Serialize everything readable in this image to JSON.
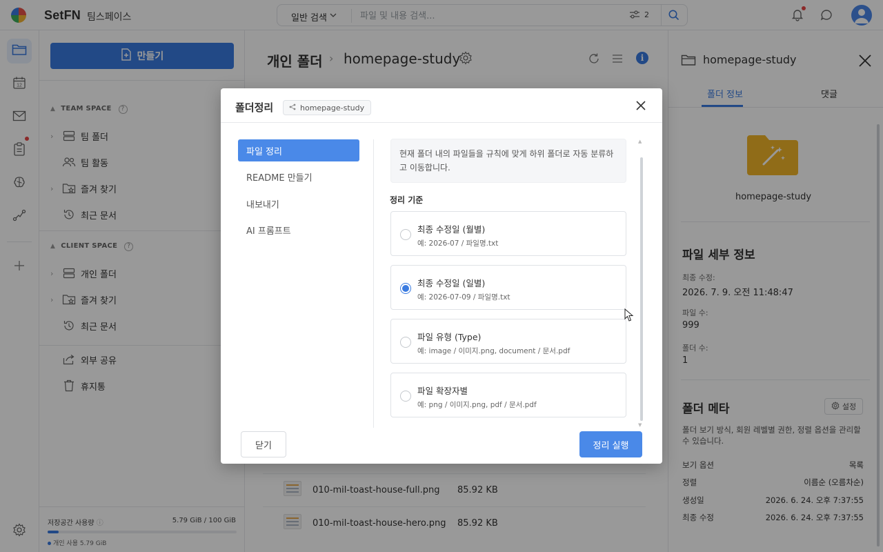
{
  "app": {
    "brand": "SetFN",
    "workspace": "팀스페이스"
  },
  "search": {
    "mode": "일반 검색",
    "placeholder": "파일 및 내용 검색...",
    "filter_count": "2"
  },
  "sidebar": {
    "create_label": "만들기",
    "team_space_label": "TEAM SPACE",
    "team_items": [
      {
        "label": "팀 폴더",
        "icon": "folder-stack-icon"
      },
      {
        "label": "팀 활동",
        "icon": "people-icon"
      },
      {
        "label": "즐겨 찾기",
        "icon": "star-folder-icon"
      },
      {
        "label": "최근 문서",
        "icon": "history-icon"
      }
    ],
    "client_space_label": "CLIENT SPACE",
    "client_items": [
      {
        "label": "개인 폴더",
        "icon": "folder-stack-icon"
      },
      {
        "label": "즐겨 찾기",
        "icon": "star-folder-icon"
      },
      {
        "label": "최근 문서",
        "icon": "history-icon"
      }
    ],
    "extra_items": [
      {
        "label": "외부 공유",
        "icon": "share-icon"
      },
      {
        "label": "휴지통",
        "icon": "trash-icon"
      }
    ],
    "storage": {
      "label": "저장공간 사용량",
      "value": "5.79 GiB / 100 GiB",
      "used_fraction": 0.058,
      "personal": "개인 사용 5.79 GiB"
    }
  },
  "main": {
    "breadcrumb_root": "개인 폴더",
    "breadcrumb_current": "homepage-study",
    "files": [
      {
        "name": "010-mil-toast-house-full.png",
        "size": "85.92 KB"
      },
      {
        "name": "010-mil-toast-house-hero.png",
        "size": "85.92 KB"
      }
    ]
  },
  "right_panel": {
    "title": "homepage-study",
    "tabs": [
      "폴더 정보",
      "댓글"
    ],
    "folder_name": "homepage-study",
    "details_heading": "파일 세부 정보",
    "last_modified_label": "최종 수정:",
    "last_modified_value": "2026. 7. 9. 오전 11:48:47",
    "file_count_label": "파일 수:",
    "file_count_value": "999",
    "folder_count_label": "폴더 수:",
    "folder_count_value": "1",
    "meta_heading": "폴더 메타",
    "settings_label": "설정",
    "meta_desc": "폴더 보기 방식, 회원 레벨별 권한, 정렬 옵션을 관리할 수 있습니다.",
    "meta_rows": [
      {
        "key": "보기 옵션",
        "value": "목록"
      },
      {
        "key": "정렬",
        "value": "이름순 (오름차순)"
      },
      {
        "key": "생성일",
        "value": "2026. 6. 24. 오후 7:37:55"
      },
      {
        "key": "최종 수정",
        "value": "2026. 6. 24. 오후 7:37:55"
      }
    ]
  },
  "modal": {
    "title": "폴더정리",
    "folder_chip": "homepage-study",
    "nav": [
      "파일 정리",
      "README 만들기",
      "내보내기",
      "AI 프롬프트"
    ],
    "active_nav": 0,
    "info": "현재 폴더 내의 파일들을 규칙에 맞게 하위 폴더로 자동 분류하고 이동합니다.",
    "section": "정리 기준",
    "options": [
      {
        "title": "최종 수정일 (월별)",
        "example": "예: 2026-07 / 파일명.txt",
        "selected": false
      },
      {
        "title": "최종 수정일 (일별)",
        "example": "예: 2026-07-09 / 파일명.txt",
        "selected": true
      },
      {
        "title": "파일 유형 (Type)",
        "example": "예: image / 이미지.png, document / 문서.pdf",
        "selected": false
      },
      {
        "title": "파일 확장자별",
        "example": "예: png / 이미지.png, pdf / 문서.pdf",
        "selected": false
      }
    ],
    "close_label": "닫기",
    "run_label": "정리 실행"
  },
  "colors": {
    "accent": "#3a7be0",
    "accent_light": "#4a89e8",
    "folder_yellow": "#f0b429",
    "badge_red": "#e64545"
  }
}
